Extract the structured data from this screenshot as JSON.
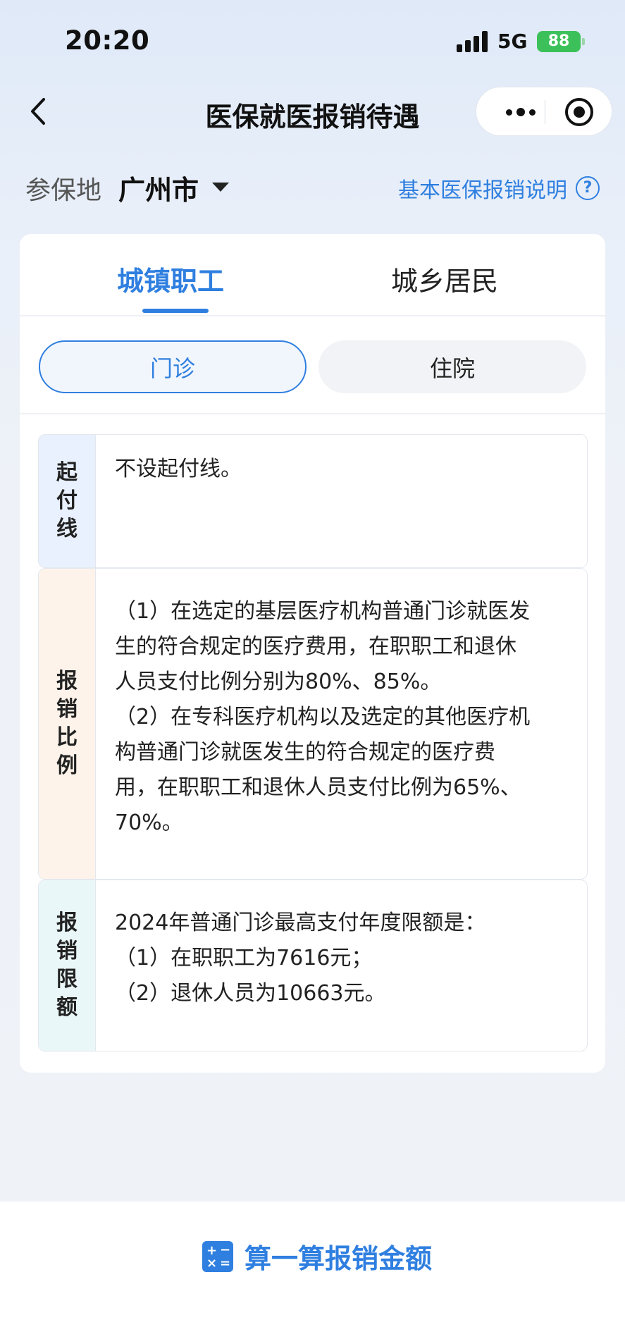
{
  "status_bar": {
    "time": "20:20",
    "network": "5G",
    "battery": "88"
  },
  "nav": {
    "title": "医保就医报销待遇"
  },
  "location": {
    "label": "参保地",
    "city": "广州市",
    "help_text": "基本医保报销说明",
    "help_icon": "?"
  },
  "tabs": [
    {
      "label": "城镇职工",
      "active": true
    },
    {
      "label": "城乡居民",
      "active": false
    }
  ],
  "segments": [
    {
      "label": "门诊",
      "active": true
    },
    {
      "label": "住院",
      "active": false
    }
  ],
  "rows": [
    {
      "label_chars": [
        "起",
        "付",
        "线"
      ],
      "lines": [
        "不设起付线。"
      ]
    },
    {
      "label_chars": [
        "报",
        "销",
        "比",
        "例"
      ],
      "lines": [
        "（1）在选定的基层医疗机构普通门诊就医发",
        "生的符合规定的医疗费用，在职职工和退休",
        "人员支付比例分别为80%、85%。",
        "（2）在专科医疗机构以及选定的其他医疗机",
        "构普通门诊就医发生的符合规定的医疗费",
        "用，在职职工和退休人员支付比例为65%、",
        "70%。"
      ]
    },
    {
      "label_chars": [
        "报",
        "销",
        "限",
        "额"
      ],
      "lines": [
        "2024年普通门诊最高支付年度限额是：",
        "（1）在职职工为7616元；",
        "（2）退休人员为10663元。"
      ]
    }
  ],
  "bottom": {
    "button_label": "算一算报销金额",
    "icon": "calculator-icon"
  },
  "colors": {
    "accent": "#2f7fe0",
    "battery": "#3cc15a"
  }
}
